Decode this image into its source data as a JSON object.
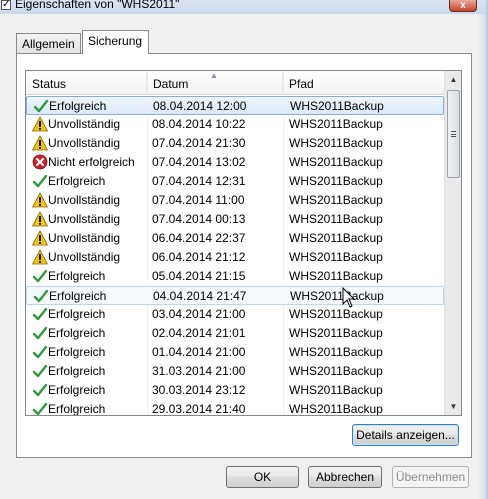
{
  "window": {
    "title": "Eigenschaften von \"WHS2011\"",
    "close_label": "x"
  },
  "tabs": [
    {
      "label": "Allgemein",
      "active": false
    },
    {
      "label": "Sicherung",
      "active": true
    }
  ],
  "list": {
    "columns": [
      "Status",
      "Datum",
      "Pfad"
    ],
    "sorted_column": "Datum",
    "rows": [
      {
        "icon": "success-check-icon",
        "status": "Erfolgreich",
        "date": "08.04.2014 12:00",
        "path": "WHS2011Backup",
        "selected": true
      },
      {
        "icon": "warning-icon",
        "status": "Unvollständig",
        "date": "08.04.2014 10:22",
        "path": "WHS2011Backup"
      },
      {
        "icon": "warning-icon",
        "status": "Unvollständig",
        "date": "07.04.2014 21:30",
        "path": "WHS2011Backup"
      },
      {
        "icon": "error-icon",
        "status": "Nicht erfolgreich",
        "date": "07.04.2014 13:02",
        "path": "WHS2011Backup"
      },
      {
        "icon": "success-check-icon",
        "status": "Erfolgreich",
        "date": "07.04.2014 12:31",
        "path": "WHS2011Backup"
      },
      {
        "icon": "warning-icon",
        "status": "Unvollständig",
        "date": "07.04.2014 11:00",
        "path": "WHS2011Backup"
      },
      {
        "icon": "warning-icon",
        "status": "Unvollständig",
        "date": "07.04.2014 00:13",
        "path": "WHS2011Backup"
      },
      {
        "icon": "warning-icon",
        "status": "Unvollständig",
        "date": "06.04.2014 22:37",
        "path": "WHS2011Backup"
      },
      {
        "icon": "warning-icon",
        "status": "Unvollständig",
        "date": "06.04.2014 21:12",
        "path": "WHS2011Backup"
      },
      {
        "icon": "success-check-icon",
        "status": "Erfolgreich",
        "date": "05.04.2014 21:15",
        "path": "WHS2011Backup"
      },
      {
        "icon": "success-check-icon",
        "status": "Erfolgreich",
        "date": "04.04.2014 21:47",
        "path": "WHS2011Backup",
        "hovered": true
      },
      {
        "icon": "success-check-icon",
        "status": "Erfolgreich",
        "date": "03.04.2014 21:00",
        "path": "WHS2011Backup"
      },
      {
        "icon": "success-check-icon",
        "status": "Erfolgreich",
        "date": "02.04.2014 21:01",
        "path": "WHS2011Backup"
      },
      {
        "icon": "success-check-icon",
        "status": "Erfolgreich",
        "date": "01.04.2014 21:00",
        "path": "WHS2011Backup"
      },
      {
        "icon": "success-check-icon",
        "status": "Erfolgreich",
        "date": "31.03.2014 21:00",
        "path": "WHS2011Backup"
      },
      {
        "icon": "success-check-icon",
        "status": "Erfolgreich",
        "date": "30.03.2014 23:12",
        "path": "WHS2011Backup"
      },
      {
        "icon": "success-check-icon",
        "status": "Erfolgreich",
        "date": "29.03.2014 21:40",
        "path": "WHS2011Backup"
      }
    ]
  },
  "buttons": {
    "details": "Details anzeigen...",
    "ok": "OK",
    "cancel": "Abbrechen",
    "apply": "Übernehmen"
  },
  "colors": {
    "success": "#2e9b3a",
    "warning": "#f2c318",
    "error": "#c0272d",
    "selection": "#dbe9fa"
  }
}
